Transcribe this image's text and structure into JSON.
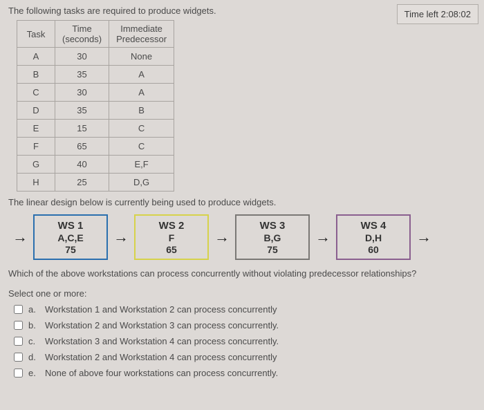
{
  "timer": "Time left 2:08:02",
  "intro": "The following tasks are required to produce widgets.",
  "table": {
    "headers": {
      "task": "Task",
      "time": "Time\n(seconds)",
      "pred": "Immediate\nPredecessor"
    },
    "rows": [
      {
        "task": "A",
        "time": "30",
        "pred": "None"
      },
      {
        "task": "B",
        "time": "35",
        "pred": "A"
      },
      {
        "task": "C",
        "time": "30",
        "pred": "A"
      },
      {
        "task": "D",
        "time": "35",
        "pred": "B"
      },
      {
        "task": "E",
        "time": "15",
        "pred": "C"
      },
      {
        "task": "F",
        "time": "65",
        "pred": "C"
      },
      {
        "task": "G",
        "time": "40",
        "pred": "E,F"
      },
      {
        "task": "H",
        "time": "25",
        "pred": "D,G"
      }
    ]
  },
  "linear_text": "The linear design below is currently being used to produce widgets.",
  "workstations": [
    {
      "title": "WS 1",
      "tasks": "A,C,E",
      "time": "75"
    },
    {
      "title": "WS 2",
      "tasks": "F",
      "time": "65"
    },
    {
      "title": "WS 3",
      "tasks": "B,G",
      "time": "75"
    },
    {
      "title": "WS 4",
      "tasks": "D,H",
      "time": "60"
    }
  ],
  "arrow": "→",
  "question": "Which of the above workstations can process concurrently without violating predecessor relationships?",
  "select_prompt": "Select one or more:",
  "options": [
    {
      "letter": "a.",
      "text": "Workstation 1 and Workstation 2 can process concurrently"
    },
    {
      "letter": "b.",
      "text": "Workstation 2 and Workstation 3 can process concurrently."
    },
    {
      "letter": "c.",
      "text": "Workstation 3 and Workstation 4 can process concurrently."
    },
    {
      "letter": "d.",
      "text": "Workstation 2 and Workstation 4 can process concurrently"
    },
    {
      "letter": "e.",
      "text": "None of above four workstations can process concurrently."
    }
  ]
}
